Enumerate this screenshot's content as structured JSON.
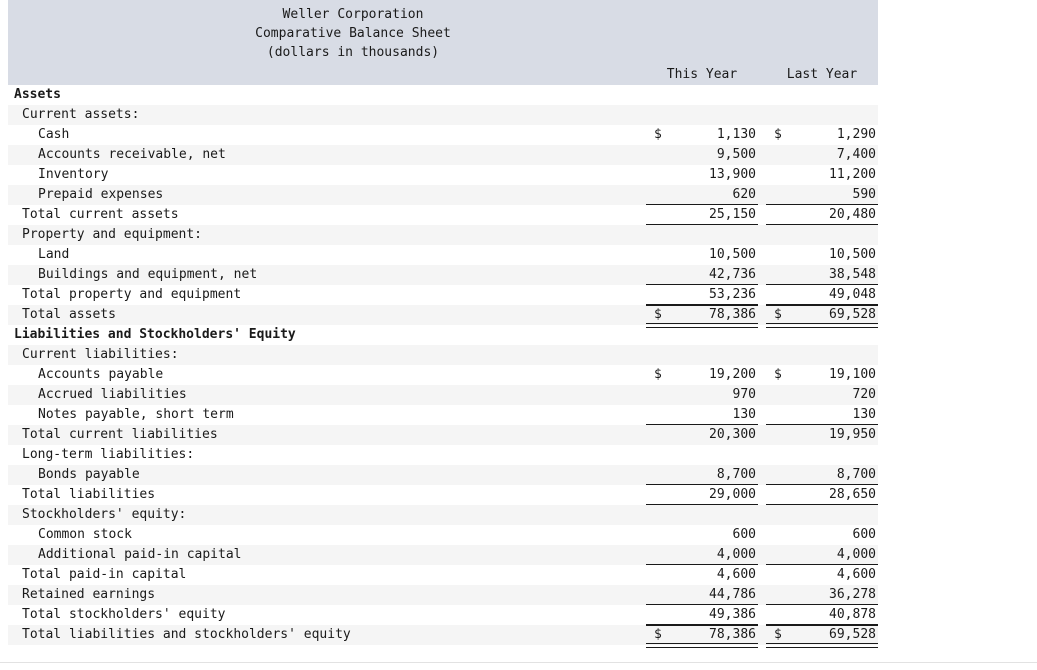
{
  "header": {
    "title_lines": [
      "Weller Corporation",
      "Comparative Balance Sheet",
      "(dollars in thousands)"
    ],
    "columns": [
      "This Year",
      "Last Year"
    ],
    "band_color": "#d8dce5"
  },
  "chart_data": {
    "type": "table",
    "title": "Weller Corporation Comparative Balance Sheet (dollars in thousands)",
    "columns": [
      "",
      "This Year",
      "Last Year"
    ],
    "rows": [
      {
        "label": "Assets",
        "this_year": "",
        "last_year": ""
      },
      {
        "label": "Current assets:",
        "this_year": "",
        "last_year": ""
      },
      {
        "label": "Cash",
        "this_year": "$ 1,130",
        "last_year": "$ 1,290"
      },
      {
        "label": "Accounts receivable, net",
        "this_year": "9,500",
        "last_year": "7,400"
      },
      {
        "label": "Inventory",
        "this_year": "13,900",
        "last_year": "11,200"
      },
      {
        "label": "Prepaid expenses",
        "this_year": "620",
        "last_year": "590"
      },
      {
        "label": "Total current assets",
        "this_year": "25,150",
        "last_year": "20,480"
      },
      {
        "label": "Property and equipment:",
        "this_year": "",
        "last_year": ""
      },
      {
        "label": "Land",
        "this_year": "10,500",
        "last_year": "10,500"
      },
      {
        "label": "Buildings and equipment, net",
        "this_year": "42,736",
        "last_year": "38,548"
      },
      {
        "label": "Total property and equipment",
        "this_year": "53,236",
        "last_year": "49,048"
      },
      {
        "label": "Total assets",
        "this_year": "$ 78,386",
        "last_year": "$ 69,528"
      },
      {
        "label": "Liabilities and Stockholders' Equity",
        "this_year": "",
        "last_year": ""
      },
      {
        "label": "Current liabilities:",
        "this_year": "",
        "last_year": ""
      },
      {
        "label": "Accounts payable",
        "this_year": "$ 19,200",
        "last_year": "$ 19,100"
      },
      {
        "label": "Accrued liabilities",
        "this_year": "970",
        "last_year": "720"
      },
      {
        "label": "Notes payable, short term",
        "this_year": "130",
        "last_year": "130"
      },
      {
        "label": "Total current liabilities",
        "this_year": "20,300",
        "last_year": "19,950"
      },
      {
        "label": "Long-term liabilities:",
        "this_year": "",
        "last_year": ""
      },
      {
        "label": "Bonds payable",
        "this_year": "8,700",
        "last_year": "8,700"
      },
      {
        "label": "Total liabilities",
        "this_year": "29,000",
        "last_year": "28,650"
      },
      {
        "label": "Stockholders' equity:",
        "this_year": "",
        "last_year": ""
      },
      {
        "label": "Common stock",
        "this_year": "600",
        "last_year": "600"
      },
      {
        "label": "Additional paid-in capital",
        "this_year": "4,000",
        "last_year": "4,000"
      },
      {
        "label": "Total paid-in capital",
        "this_year": "4,600",
        "last_year": "4,600"
      },
      {
        "label": "Retained earnings",
        "this_year": "44,786",
        "last_year": "36,278"
      },
      {
        "label": "Total stockholders' equity",
        "this_year": "49,386",
        "last_year": "40,878"
      },
      {
        "label": "Total liabilities and stockholders' equity",
        "this_year": "$ 78,386",
        "last_year": "$ 69,528"
      }
    ]
  },
  "rows": [
    {
      "label": "Assets",
      "indent": 0,
      "bold": true,
      "this_year": "",
      "last_year": "",
      "cur1": "",
      "cur2": "",
      "rule": "none",
      "alt": false
    },
    {
      "label": "Current assets:",
      "indent": 1,
      "bold": false,
      "this_year": "",
      "last_year": "",
      "cur1": "",
      "cur2": "",
      "rule": "none",
      "alt": true
    },
    {
      "label": "Cash",
      "indent": 2,
      "bold": false,
      "this_year": "1,130",
      "last_year": "1,290",
      "cur1": "$",
      "cur2": "$",
      "rule": "none",
      "alt": false
    },
    {
      "label": "Accounts receivable, net",
      "indent": 2,
      "bold": false,
      "this_year": "9,500",
      "last_year": "7,400",
      "cur1": "",
      "cur2": "",
      "rule": "none",
      "alt": true
    },
    {
      "label": "Inventory",
      "indent": 2,
      "bold": false,
      "this_year": "13,900",
      "last_year": "11,200",
      "cur1": "",
      "cur2": "",
      "rule": "none",
      "alt": false
    },
    {
      "label": "Prepaid expenses",
      "indent": 2,
      "bold": false,
      "this_year": "620",
      "last_year": "590",
      "cur1": "",
      "cur2": "",
      "rule": "bottom",
      "alt": true
    },
    {
      "label": "Total current assets",
      "indent": 1,
      "bold": false,
      "this_year": "25,150",
      "last_year": "20,480",
      "cur1": "",
      "cur2": "",
      "rule": "bottom",
      "alt": false
    },
    {
      "label": "Property and equipment:",
      "indent": 1,
      "bold": false,
      "this_year": "",
      "last_year": "",
      "cur1": "",
      "cur2": "",
      "rule": "none",
      "alt": true
    },
    {
      "label": "Land",
      "indent": 2,
      "bold": false,
      "this_year": "10,500",
      "last_year": "10,500",
      "cur1": "",
      "cur2": "",
      "rule": "none",
      "alt": false
    },
    {
      "label": "Buildings and equipment, net",
      "indent": 2,
      "bold": false,
      "this_year": "42,736",
      "last_year": "38,548",
      "cur1": "",
      "cur2": "",
      "rule": "bottom",
      "alt": true
    },
    {
      "label": "Total property and equipment",
      "indent": 1,
      "bold": false,
      "this_year": "53,236",
      "last_year": "49,048",
      "cur1": "",
      "cur2": "",
      "rule": "bottom",
      "alt": false
    },
    {
      "label": "Total assets",
      "indent": 1,
      "bold": false,
      "this_year": "78,386",
      "last_year": "69,528",
      "cur1": "$",
      "cur2": "$",
      "rule": "grand",
      "alt": true
    },
    {
      "label": "Liabilities and Stockholders' Equity",
      "indent": 0,
      "bold": true,
      "this_year": "",
      "last_year": "",
      "cur1": "",
      "cur2": "",
      "rule": "none",
      "alt": false
    },
    {
      "label": "Current liabilities:",
      "indent": 1,
      "bold": false,
      "this_year": "",
      "last_year": "",
      "cur1": "",
      "cur2": "",
      "rule": "none",
      "alt": true
    },
    {
      "label": "Accounts payable",
      "indent": 2,
      "bold": false,
      "this_year": "19,200",
      "last_year": "19,100",
      "cur1": "$",
      "cur2": "$",
      "rule": "none",
      "alt": false
    },
    {
      "label": "Accrued liabilities",
      "indent": 2,
      "bold": false,
      "this_year": "970",
      "last_year": "720",
      "cur1": "",
      "cur2": "",
      "rule": "none",
      "alt": true
    },
    {
      "label": "Notes payable, short term",
      "indent": 2,
      "bold": false,
      "this_year": "130",
      "last_year": "130",
      "cur1": "",
      "cur2": "",
      "rule": "bottom",
      "alt": false
    },
    {
      "label": "Total current liabilities",
      "indent": 1,
      "bold": false,
      "this_year": "20,300",
      "last_year": "19,950",
      "cur1": "",
      "cur2": "",
      "rule": "none",
      "alt": true
    },
    {
      "label": "Long-term liabilities:",
      "indent": 1,
      "bold": false,
      "this_year": "",
      "last_year": "",
      "cur1": "",
      "cur2": "",
      "rule": "none",
      "alt": false
    },
    {
      "label": "Bonds payable",
      "indent": 2,
      "bold": false,
      "this_year": "8,700",
      "last_year": "8,700",
      "cur1": "",
      "cur2": "",
      "rule": "bottom",
      "alt": true
    },
    {
      "label": "Total liabilities",
      "indent": 1,
      "bold": false,
      "this_year": "29,000",
      "last_year": "28,650",
      "cur1": "",
      "cur2": "",
      "rule": "bottom",
      "alt": false
    },
    {
      "label": "Stockholders' equity:",
      "indent": 1,
      "bold": false,
      "this_year": "",
      "last_year": "",
      "cur1": "",
      "cur2": "",
      "rule": "none",
      "alt": true
    },
    {
      "label": "Common stock",
      "indent": 2,
      "bold": false,
      "this_year": "600",
      "last_year": "600",
      "cur1": "",
      "cur2": "",
      "rule": "none",
      "alt": false
    },
    {
      "label": "Additional paid-in capital",
      "indent": 2,
      "bold": false,
      "this_year": "4,000",
      "last_year": "4,000",
      "cur1": "",
      "cur2": "",
      "rule": "bottom",
      "alt": true
    },
    {
      "label": "Total paid-in capital",
      "indent": 1,
      "bold": false,
      "this_year": "4,600",
      "last_year": "4,600",
      "cur1": "",
      "cur2": "",
      "rule": "none",
      "alt": false
    },
    {
      "label": "Retained earnings",
      "indent": 1,
      "bold": false,
      "this_year": "44,786",
      "last_year": "36,278",
      "cur1": "",
      "cur2": "",
      "rule": "bottom",
      "alt": true
    },
    {
      "label": "Total stockholders' equity",
      "indent": 1,
      "bold": false,
      "this_year": "49,386",
      "last_year": "40,878",
      "cur1": "",
      "cur2": "",
      "rule": "bottom",
      "alt": false
    },
    {
      "label": "Total liabilities and stockholders' equity",
      "indent": 1,
      "bold": false,
      "this_year": "78,386",
      "last_year": "69,528",
      "cur1": "$",
      "cur2": "$",
      "rule": "grand",
      "alt": true
    }
  ]
}
